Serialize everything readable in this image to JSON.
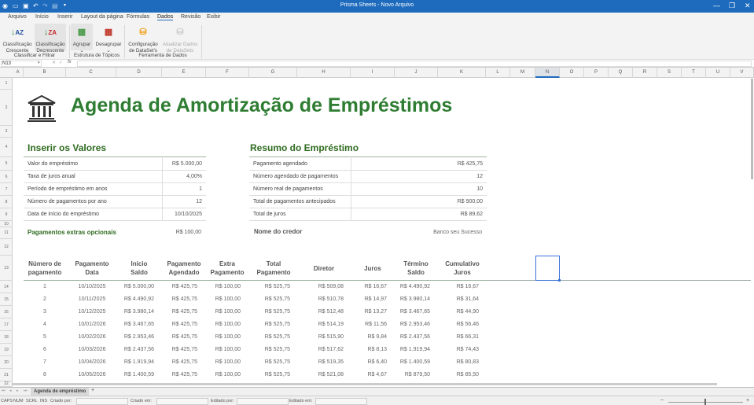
{
  "window": {
    "title": "Prisma Sheets - Novo Arquivo"
  },
  "menu": [
    "Arquivo",
    "Início",
    "Inserir",
    "Layout da página",
    "Fórmulas",
    "Dados",
    "Revisão",
    "Exibir"
  ],
  "active_menu": "Dados",
  "ribbon": {
    "sort_asc": [
      "Classificação",
      "Crescente"
    ],
    "sort_desc": [
      "Classificação",
      "Decrescente"
    ],
    "group": "Agrupar",
    "ungroup": "Desagrupar",
    "dataset_config": [
      "Configuração",
      "de DataSet's"
    ],
    "dataset_refresh": [
      "Atualizar Dados",
      "de DataSets"
    ],
    "groups": [
      "Classificar e Filtrar",
      "Estrutura de Tópicos",
      "Ferramenta de Dados"
    ]
  },
  "formula_bar": {
    "name_box": "N13",
    "formula": ""
  },
  "columns": [
    "A",
    "B",
    "C",
    "D",
    "E",
    "F",
    "G",
    "H",
    "I",
    "J",
    "K",
    "L",
    "M",
    "N",
    "O",
    "P",
    "Q",
    "R",
    "S",
    "T",
    "U",
    "V"
  ],
  "selected_column": "N",
  "rows": [
    "1",
    "2",
    "3",
    "4",
    "5",
    "6",
    "7",
    "8",
    "9",
    "10",
    "11",
    "12",
    "13",
    "14",
    "15",
    "16",
    "17",
    "18",
    "19",
    "20",
    "21",
    "22"
  ],
  "sheet": {
    "title": "Agenda de Amortização de Empréstimos",
    "inputs_title": "Inserir os Valores",
    "inputs": [
      {
        "label": "Valor do empréstimo",
        "value": "R$ 5.000,00"
      },
      {
        "label": "Taxa de juros anual",
        "value": "4,00%"
      },
      {
        "label": "Período de empréstimo em anos",
        "value": "1"
      },
      {
        "label": "Número de pagamentos por ano",
        "value": "12"
      },
      {
        "label": "Data de início do empréstimo",
        "value": "10/10/2025"
      }
    ],
    "extra_label": "Pagamentos extras opcionais",
    "extra_value": "R$ 100,00",
    "summary_title": "Resumo do Empréstimo",
    "summary": [
      {
        "label": "Pagamento agendado",
        "value": "R$ 425,75"
      },
      {
        "label": "Número agendado de pagamentos",
        "value": "12"
      },
      {
        "label": "Número real de pagamentos",
        "value": "10"
      },
      {
        "label": "Total de pagamentos antecipados",
        "value": "R$ 900,00"
      },
      {
        "label": "Total de juros",
        "value": "R$ 89,62"
      }
    ],
    "lender_label": "Nome do credor",
    "lender_value": "Banco seu Sucesso",
    "table_headers": [
      [
        "Número de",
        "pagamento"
      ],
      [
        "Pagamento",
        "Data"
      ],
      [
        "Início",
        "Saldo"
      ],
      [
        "Pagamento",
        "Agendado"
      ],
      [
        "Extra",
        "Pagamento"
      ],
      [
        "Total",
        "Pagamento"
      ],
      [
        "Diretor",
        ""
      ],
      [
        "Juros",
        ""
      ],
      [
        "Término",
        "Saldo"
      ],
      [
        "Cumulativo",
        "Juros"
      ]
    ],
    "table_rows": [
      [
        "1",
        "10/10/2025",
        "R$ 5.000,00",
        "R$ 425,75",
        "R$ 100,00",
        "R$ 525,75",
        "R$ 509,08",
        "R$ 16,67",
        "R$ 4.490,92",
        "R$ 16,67"
      ],
      [
        "2",
        "10/11/2025",
        "R$ 4.490,92",
        "R$ 425,75",
        "R$ 100,00",
        "R$ 525,75",
        "R$ 510,78",
        "R$ 14,97",
        "R$ 3.980,14",
        "R$ 31,64"
      ],
      [
        "3",
        "10/12/2025",
        "R$ 3.980,14",
        "R$ 425,75",
        "R$ 100,00",
        "R$ 525,75",
        "R$ 512,48",
        "R$ 13,27",
        "R$ 3.467,65",
        "R$ 44,90"
      ],
      [
        "4",
        "10/01/2026",
        "R$ 3.467,65",
        "R$ 425,75",
        "R$ 100,00",
        "R$ 525,75",
        "R$ 514,19",
        "R$ 11,56",
        "R$ 2.953,46",
        "R$ 56,46"
      ],
      [
        "5",
        "10/02/2026",
        "R$ 2.953,46",
        "R$ 425,75",
        "R$ 100,00",
        "R$ 525,75",
        "R$ 515,90",
        "R$ 9,84",
        "R$ 2.437,56",
        "R$ 66,31"
      ],
      [
        "6",
        "10/03/2026",
        "R$ 2.437,56",
        "R$ 425,75",
        "R$ 100,00",
        "R$ 525,75",
        "R$ 517,62",
        "R$ 8,13",
        "R$ 1.919,94",
        "R$ 74,43"
      ],
      [
        "7",
        "10/04/2026",
        "R$ 1.919,94",
        "R$ 425,75",
        "R$ 100,00",
        "R$ 525,75",
        "R$ 519,35",
        "R$ 6,40",
        "R$ 1.400,59",
        "R$ 80,83"
      ],
      [
        "8",
        "10/05/2026",
        "R$ 1.400,59",
        "R$ 425,75",
        "R$ 100,00",
        "R$ 525,75",
        "R$ 521,08",
        "R$ 4,67",
        "R$ 879,50",
        "R$ 85,50"
      ]
    ]
  },
  "tabs": {
    "active": "Agenda de empréstimo",
    "add": "+"
  },
  "status": {
    "caps": "CAPS",
    "num": "NUM",
    "scrl": "SCRL",
    "ins": "INS",
    "created_by": "Criado por:",
    "created_at": "Criado em:",
    "edited_by": "Editado por:",
    "edited_at": "Editado em:"
  }
}
